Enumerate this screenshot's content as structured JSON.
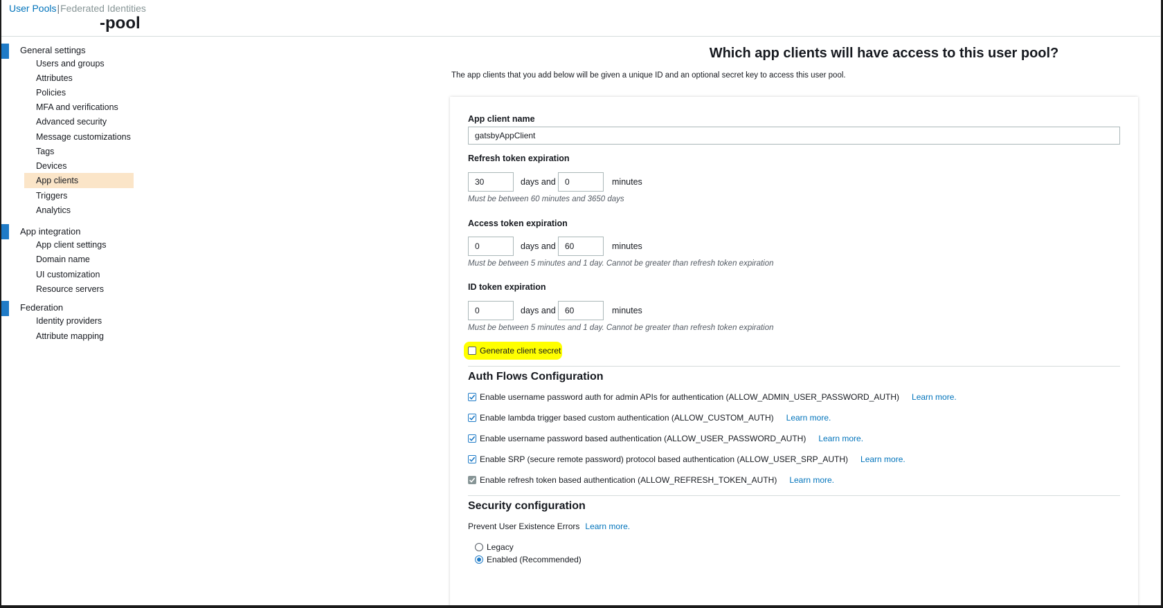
{
  "header": {
    "user_pools_link": "User Pools",
    "separator": "|",
    "federated_identities_link": "Federated Identities",
    "pool_name": "-pool"
  },
  "sidebar": {
    "groups": [
      {
        "title": "General settings",
        "items": [
          "Users and groups",
          "Attributes",
          "Policies",
          "MFA and verifications",
          "Advanced security",
          "Message customizations",
          "Tags",
          "Devices",
          "App clients",
          "Triggers",
          "Analytics"
        ]
      },
      {
        "title": "App integration",
        "items": [
          "App client settings",
          "Domain name",
          "UI customization",
          "Resource servers"
        ]
      },
      {
        "title": "Federation",
        "items": [
          "Identity providers",
          "Attribute mapping"
        ]
      }
    ],
    "active_item": "App clients"
  },
  "main": {
    "heading": "Which app clients will have access to this user pool?",
    "subtitle": "The app clients that you add below will be given a unique ID and an optional secret key to access this user pool.",
    "app_client_name": {
      "label": "App client name",
      "value": "gatsbyAppClient"
    },
    "refresh_token": {
      "label": "Refresh token expiration",
      "days_value": "30",
      "days_text": "days and",
      "minutes_value": "0",
      "minutes_text": "minutes",
      "hint": "Must be between 60 minutes and 3650 days"
    },
    "access_token": {
      "label": "Access token expiration",
      "days_value": "0",
      "days_text": "days and",
      "minutes_value": "60",
      "minutes_text": "minutes",
      "hint": "Must be between 5 minutes and 1 day. Cannot be greater than refresh token expiration"
    },
    "id_token": {
      "label": "ID token expiration",
      "days_value": "0",
      "days_text": "days and",
      "minutes_value": "60",
      "minutes_text": "minutes",
      "hint": "Must be between 5 minutes and 1 day. Cannot be greater than refresh token expiration"
    },
    "generate_secret": {
      "label": "Generate client secret",
      "checked": false,
      "highlight_color": "#ffff00"
    },
    "auth_flows": {
      "title": "Auth Flows Configuration",
      "learn_more": "Learn more.",
      "options": [
        {
          "label": "Enable username password auth for admin APIs for authentication (ALLOW_ADMIN_USER_PASSWORD_AUTH)",
          "checked": true,
          "disabled": false
        },
        {
          "label": "Enable lambda trigger based custom authentication (ALLOW_CUSTOM_AUTH)",
          "checked": true,
          "disabled": false
        },
        {
          "label": "Enable username password based authentication (ALLOW_USER_PASSWORD_AUTH)",
          "checked": true,
          "disabled": false
        },
        {
          "label": "Enable SRP (secure remote password) protocol based authentication (ALLOW_USER_SRP_AUTH)",
          "checked": true,
          "disabled": false
        },
        {
          "label": "Enable refresh token based authentication (ALLOW_REFRESH_TOKEN_AUTH)",
          "checked": true,
          "disabled": true
        }
      ]
    },
    "security": {
      "title": "Security configuration",
      "prevent_label": "Prevent User Existence Errors",
      "learn_more": "Learn more.",
      "options": [
        {
          "label": "Legacy",
          "checked": false
        },
        {
          "label": "Enabled (Recommended)",
          "checked": true
        }
      ]
    }
  },
  "colors": {
    "link": "#0073bb",
    "accent": "#1f7bc7",
    "active_nav_bg": "#fbe5c8",
    "highlight": "#ffff00"
  }
}
